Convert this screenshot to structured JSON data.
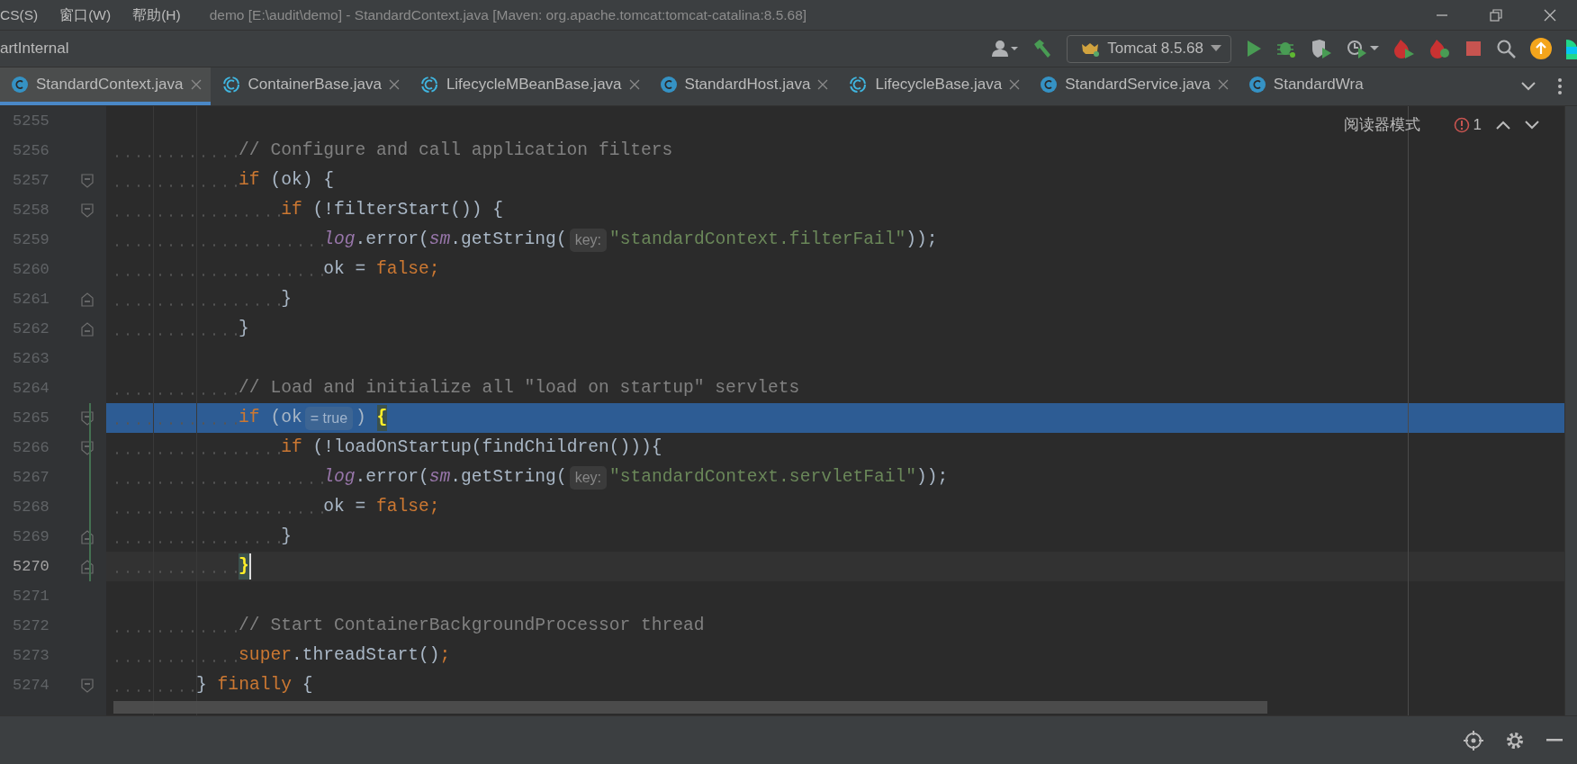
{
  "menu": [
    "CS(S)",
    "窗口(W)",
    "帮助(H)"
  ],
  "window": {
    "title": "demo [E:\\audit\\demo] - StandardContext.java [Maven: org.apache.tomcat:tomcat-catalina:8.5.68]"
  },
  "toolbar": {
    "breadcrumb": "artInternal",
    "run_config": "Tomcat 8.5.68"
  },
  "tabs": [
    {
      "label": "StandardContext.java",
      "kind": "class",
      "selected": true,
      "closable": true
    },
    {
      "label": "ContainerBase.java",
      "kind": "abstract",
      "selected": false,
      "closable": true
    },
    {
      "label": "LifecycleMBeanBase.java",
      "kind": "abstract",
      "selected": false,
      "closable": true
    },
    {
      "label": "StandardHost.java",
      "kind": "class",
      "selected": false,
      "closable": true
    },
    {
      "label": "LifecycleBase.java",
      "kind": "abstract",
      "selected": false,
      "closable": true
    },
    {
      "label": "StandardService.java",
      "kind": "class",
      "selected": false,
      "closable": true
    },
    {
      "label": "StandardWra",
      "kind": "class",
      "selected": false,
      "closable": false
    }
  ],
  "editor_header": {
    "reader_mode": "阅读器模式",
    "problems": "1"
  },
  "lines": [
    {
      "number": "5255",
      "selected": false,
      "current": false,
      "modified": false,
      "fold_open": false,
      "fold_close": false
    },
    {
      "number": "5256",
      "selected": false,
      "current": false,
      "modified": false,
      "fold_open": false,
      "fold_close": false,
      "tokens": [
        {
          "kind": "comment",
          "text": "            // Configure and call application filters"
        }
      ]
    },
    {
      "number": "5257",
      "selected": false,
      "current": false,
      "modified": false,
      "fold_open": true,
      "fold_close": false,
      "tokens": [
        {
          "kind": "keyword",
          "text": "            if"
        },
        {
          "kind": "plain",
          "text": " (ok) {"
        }
      ]
    },
    {
      "number": "5258",
      "selected": false,
      "current": false,
      "modified": false,
      "fold_open": true,
      "fold_close": false,
      "tokens": [
        {
          "kind": "keyword",
          "text": "                if"
        },
        {
          "kind": "plain",
          "text": " (!filterStart()) {"
        }
      ]
    },
    {
      "number": "5259",
      "selected": false,
      "current": false,
      "modified": false,
      "fold_open": false,
      "fold_close": false,
      "tokens": [
        {
          "kind": "field",
          "text": "                    log"
        },
        {
          "kind": "plain",
          "text": ".error("
        },
        {
          "kind": "field",
          "text": "sm"
        },
        {
          "kind": "plain",
          "text": ".getString("
        },
        {
          "kind": "hint",
          "text": "key:"
        },
        {
          "kind": "string",
          "text": "\"standardContext.filterFail\""
        },
        {
          "kind": "plain",
          "text": "));"
        }
      ]
    },
    {
      "number": "5260",
      "selected": false,
      "current": false,
      "modified": false,
      "fold_open": false,
      "fold_close": false,
      "tokens": [
        {
          "kind": "plain",
          "text": "                    ok = "
        },
        {
          "kind": "keyword",
          "text": "false;"
        }
      ]
    },
    {
      "number": "5261",
      "selected": false,
      "current": false,
      "modified": false,
      "fold_open": false,
      "fold_close": true,
      "tokens": [
        {
          "kind": "plain",
          "text": "                }"
        }
      ]
    },
    {
      "number": "5262",
      "selected": false,
      "current": false,
      "modified": false,
      "fold_open": false,
      "fold_close": true,
      "tokens": [
        {
          "kind": "plain",
          "text": "            }"
        }
      ]
    },
    {
      "number": "5263",
      "selected": false,
      "current": false,
      "modified": false,
      "fold_open": false,
      "fold_close": false
    },
    {
      "number": "5264",
      "selected": false,
      "current": false,
      "modified": false,
      "fold_open": false,
      "fold_close": false,
      "tokens": [
        {
          "kind": "comment",
          "text": "            // Load and initialize all \"load on startup\" servlets"
        }
      ]
    },
    {
      "number": "5265",
      "selected": true,
      "current": false,
      "modified": true,
      "fold_open": true,
      "fold_close": false,
      "tokens": [
        {
          "kind": "keyword",
          "text": "            if"
        },
        {
          "kind": "plain",
          "text": " (ok"
        },
        {
          "kind": "hint",
          "text": "= true"
        },
        {
          "kind": "plain",
          "text": ") "
        },
        {
          "kind": "brace",
          "text": "{"
        }
      ]
    },
    {
      "number": "5266",
      "selected": false,
      "current": false,
      "modified": true,
      "fold_open": true,
      "fold_close": false,
      "tokens": [
        {
          "kind": "keyword",
          "text": "                if"
        },
        {
          "kind": "plain",
          "text": " (!loadOnStartup(findChildren())){"
        }
      ]
    },
    {
      "number": "5267",
      "selected": false,
      "current": false,
      "modified": true,
      "fold_open": false,
      "fold_close": false,
      "tokens": [
        {
          "kind": "field",
          "text": "                    log"
        },
        {
          "kind": "plain",
          "text": ".error("
        },
        {
          "kind": "field",
          "text": "sm"
        },
        {
          "kind": "plain",
          "text": ".getString("
        },
        {
          "kind": "hint",
          "text": "key:"
        },
        {
          "kind": "string",
          "text": "\"standardContext.servletFail\""
        },
        {
          "kind": "plain",
          "text": "));"
        }
      ]
    },
    {
      "number": "5268",
      "selected": false,
      "current": false,
      "modified": true,
      "fold_open": false,
      "fold_close": false,
      "tokens": [
        {
          "kind": "plain",
          "text": "                    ok = "
        },
        {
          "kind": "keyword",
          "text": "false;"
        }
      ]
    },
    {
      "number": "5269",
      "selected": false,
      "current": false,
      "modified": true,
      "fold_open": false,
      "fold_close": true,
      "tokens": [
        {
          "kind": "plain",
          "text": "                }"
        }
      ]
    },
    {
      "number": "5270",
      "selected": false,
      "current": true,
      "modified": true,
      "fold_open": false,
      "fold_close": true,
      "tokens": [
        {
          "kind": "brace",
          "text": "            }"
        }
      ]
    },
    {
      "number": "5271",
      "selected": false,
      "current": false,
      "modified": false,
      "fold_open": false,
      "fold_close": false
    },
    {
      "number": "5272",
      "selected": false,
      "current": false,
      "modified": false,
      "fold_open": false,
      "fold_close": false,
      "tokens": [
        {
          "kind": "comment",
          "text": "            // Start ContainerBackgroundProcessor thread"
        }
      ]
    },
    {
      "number": "5273",
      "selected": false,
      "current": false,
      "modified": false,
      "fold_open": false,
      "fold_close": false,
      "tokens": [
        {
          "kind": "keyword",
          "text": "            super"
        },
        {
          "kind": "plain",
          "text": ".threadStart()"
        },
        {
          "kind": "keyword",
          "text": ";"
        }
      ]
    },
    {
      "number": "5274",
      "selected": false,
      "current": false,
      "modified": false,
      "fold_open": true,
      "fold_close": false,
      "tokens": [
        {
          "kind": "plain",
          "text": "        } "
        },
        {
          "kind": "keyword",
          "text": "finally"
        },
        {
          "kind": "plain",
          "text": " {"
        }
      ]
    }
  ]
}
